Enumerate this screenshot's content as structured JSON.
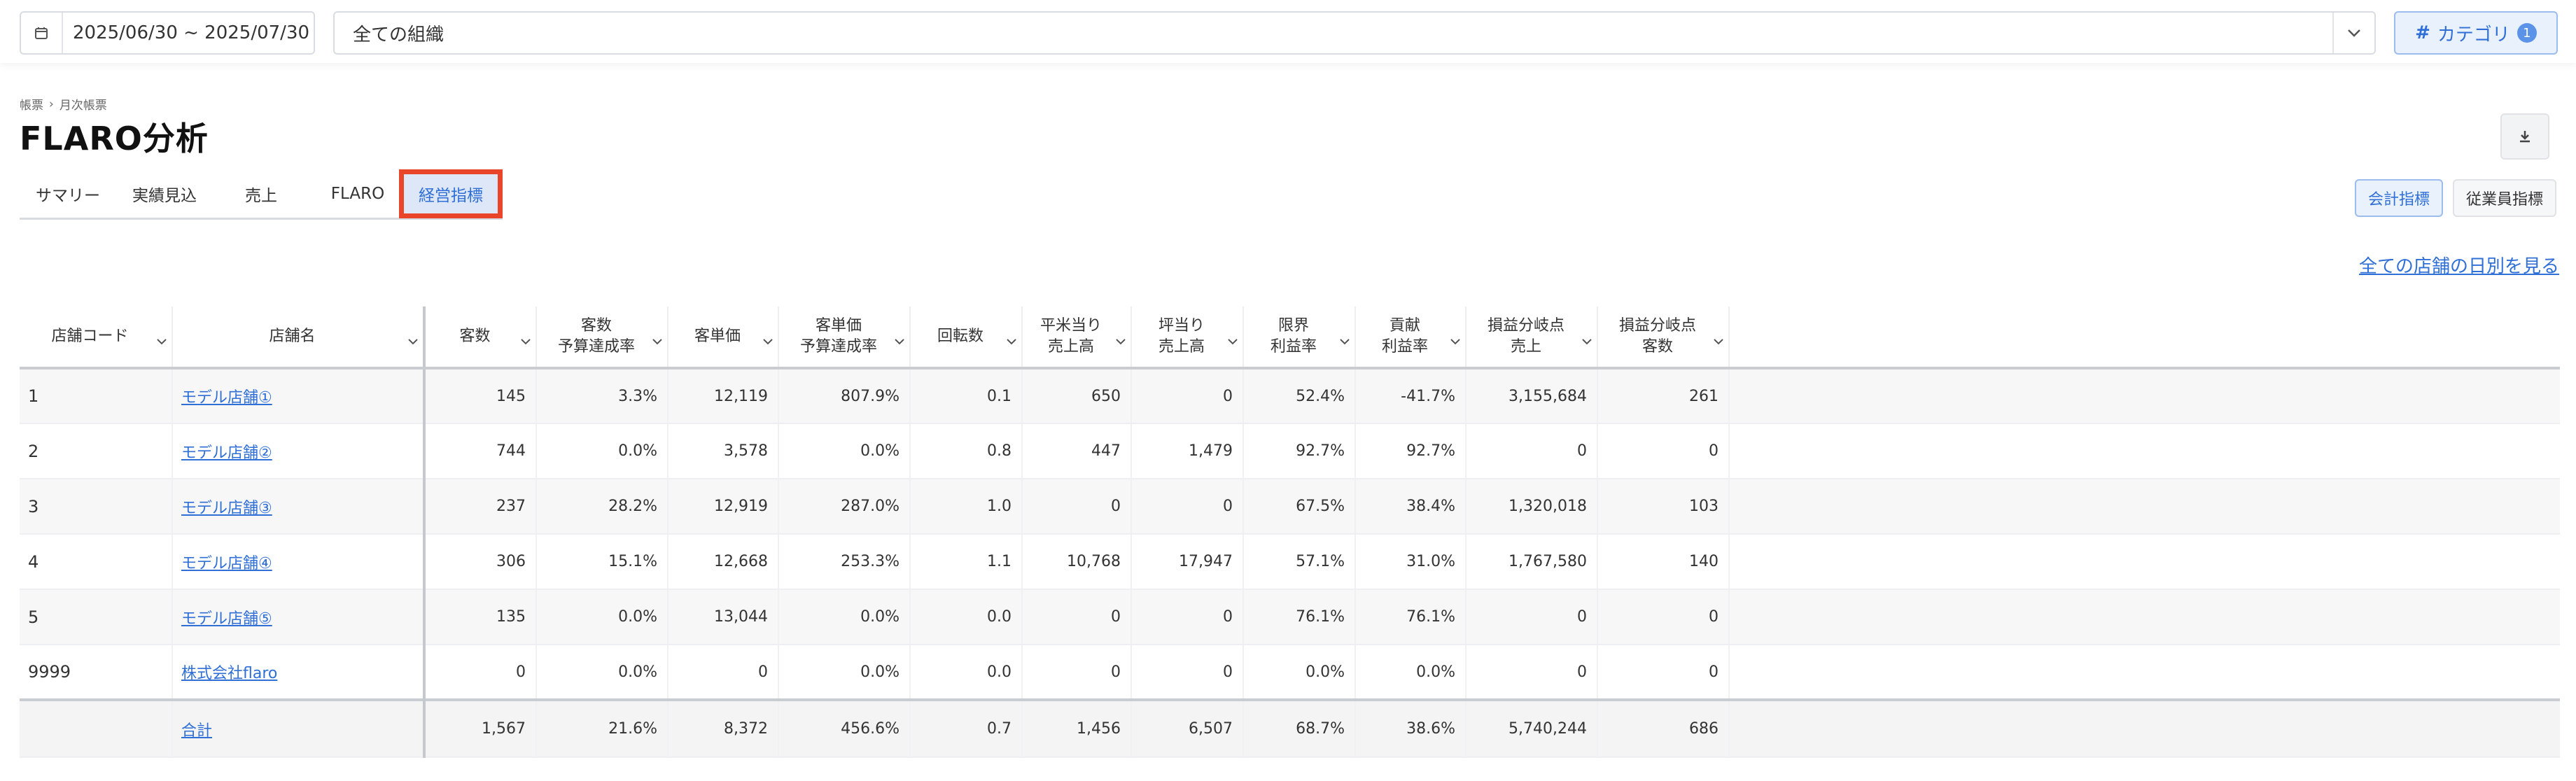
{
  "filters": {
    "date_range": "2025/06/30 ~ 2025/07/30",
    "organization": "全ての組織",
    "category_label": "カテゴリ",
    "category_count": "1"
  },
  "breadcrumb": {
    "root": "帳票",
    "separator": "›",
    "current": "月次帳票"
  },
  "page_title": "FLARO分析",
  "tabs": [
    "サマリー",
    "実績見込",
    "売上",
    "FLARO",
    "経営指標"
  ],
  "active_tab": "経営指標",
  "view_toggle": {
    "accounting": "会計指標",
    "employee": "従業員指標"
  },
  "daily_link": "全ての店舗の日別を見る",
  "table": {
    "columns": [
      [
        "店舗コード"
      ],
      [
        "店舗名"
      ],
      [
        "客数"
      ],
      [
        "客数",
        "予算達成率"
      ],
      [
        "客単価"
      ],
      [
        "客単価",
        "予算達成率"
      ],
      [
        "回転数"
      ],
      [
        "平米当り",
        "売上高"
      ],
      [
        "坪当り",
        "売上高"
      ],
      [
        "限界",
        "利益率"
      ],
      [
        "貢献",
        "利益率"
      ],
      [
        "損益分岐点",
        "売上"
      ],
      [
        "損益分岐点",
        "客数"
      ]
    ],
    "rows": [
      [
        "1",
        "モデル店舗①",
        "145",
        "3.3%",
        "12,119",
        "807.9%",
        "0.1",
        "650",
        "0",
        "52.4%",
        "-41.7%",
        "3,155,684",
        "261"
      ],
      [
        "2",
        "モデル店舗②",
        "744",
        "0.0%",
        "3,578",
        "0.0%",
        "0.8",
        "447",
        "1,479",
        "92.7%",
        "92.7%",
        "0",
        "0"
      ],
      [
        "3",
        "モデル店舗③",
        "237",
        "28.2%",
        "12,919",
        "287.0%",
        "1.0",
        "0",
        "0",
        "67.5%",
        "38.4%",
        "1,320,018",
        "103"
      ],
      [
        "4",
        "モデル店舗④",
        "306",
        "15.1%",
        "12,668",
        "253.3%",
        "1.1",
        "10,768",
        "17,947",
        "57.1%",
        "31.0%",
        "1,767,580",
        "140"
      ],
      [
        "5",
        "モデル店舗⑤",
        "135",
        "0.0%",
        "13,044",
        "0.0%",
        "0.0",
        "0",
        "0",
        "76.1%",
        "76.1%",
        "0",
        "0"
      ],
      [
        "9999",
        "株式会社flaro",
        "0",
        "0.0%",
        "0",
        "0.0%",
        "0.0",
        "0",
        "0",
        "0.0%",
        "0.0%",
        "0",
        "0"
      ]
    ],
    "total": [
      "",
      "合計",
      "1,567",
      "21.6%",
      "8,372",
      "456.6%",
      "0.7",
      "1,456",
      "6,507",
      "68.7%",
      "38.6%",
      "5,740,244",
      "686"
    ]
  },
  "colors": {
    "accent": "#2f6fd6",
    "highlight_border": "#e8452b"
  }
}
